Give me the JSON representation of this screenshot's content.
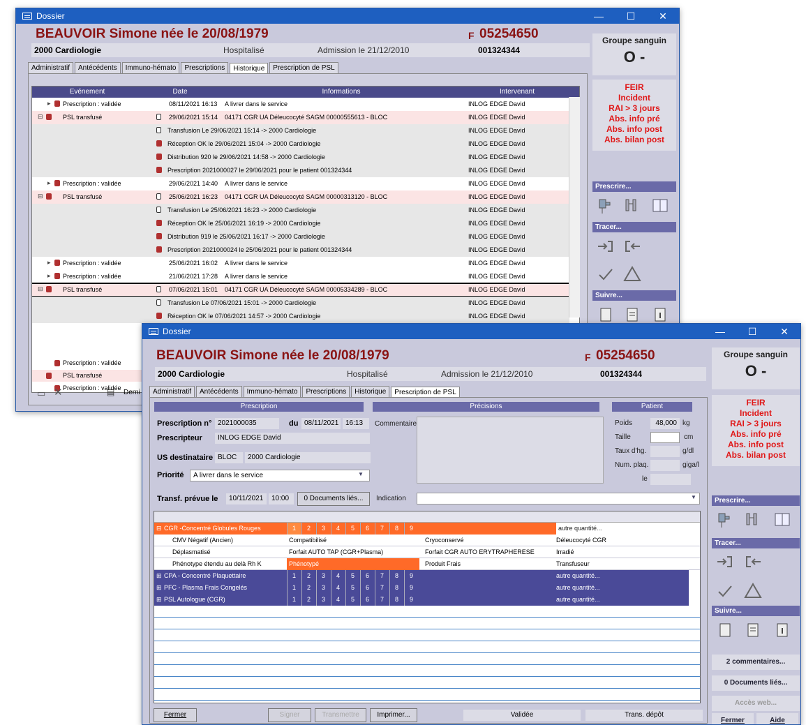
{
  "app": {
    "title": "Dossier"
  },
  "patient": {
    "name": "BEAUVOIR Simone née le 20/08/1979",
    "sex": "F",
    "number": "05254650",
    "service": "2000 Cardiologie",
    "status": "Hospitalisé",
    "admission": "Admission le 21/12/2010",
    "id": "001324344"
  },
  "blood": {
    "title": "Groupe sanguin",
    "value": "O -"
  },
  "alerts": [
    "FEIR",
    "Incident",
    "RAI > 3 jours",
    "Abs. info pré",
    "Abs. info post",
    "Abs. bilan post"
  ],
  "tabs": [
    "Administratif",
    "Antécédents",
    "Immuno-hémato",
    "Prescriptions",
    "Historique",
    "Prescription de PSL"
  ],
  "side": {
    "prescrire": "Prescrire...",
    "tracer": "Tracer...",
    "suivre": "Suivre...",
    "comments": "2 commentaires...",
    "docs": "0 Documents liés...",
    "acces_web": "Accès web...",
    "fermer": "Fermer",
    "aide": "Aide"
  },
  "history": {
    "columns": [
      "Evénement",
      "Date",
      "Informations",
      "Intervenant"
    ],
    "rows": [
      {
        "event": "Prescription : validée",
        "date": "08/11/2021 16:13",
        "info": "A livrer dans le service",
        "who": "INLOG EDGE David",
        "style": "w",
        "ico": "rx"
      },
      {
        "event": "PSL transfusé",
        "date": "29/06/2021 15:14",
        "info": "04171 CGR UA Déleucocyté SAGM 00000555613 - BLOC",
        "who": "INLOG EDGE David",
        "style": "p",
        "ico": "bag"
      },
      {
        "event": "",
        "date": "",
        "info": "Transfusion Le 29/06/2021 15:14 -> 2000 Cardiologie",
        "who": "INLOG EDGE David",
        "style": "g",
        "ico": "bag2"
      },
      {
        "event": "",
        "date": "",
        "info": "Réception OK le 29/06/2021 15:04 -> 2000 Cardiologie",
        "who": "INLOG EDGE David",
        "style": "g",
        "ico": "rec"
      },
      {
        "event": "",
        "date": "",
        "info": "Distribution 920 le 29/06/2021 14:58 -> 2000 Cardiologie",
        "who": "INLOG EDGE David",
        "style": "g",
        "ico": "dis"
      },
      {
        "event": "",
        "date": "",
        "info": "Prescription 2021000027 le 29/06/2021 pour le patient 001324344",
        "who": "INLOG EDGE David",
        "style": "g",
        "ico": "rx"
      },
      {
        "event": "Prescription : validée",
        "date": "29/06/2021 14:40",
        "info": "A livrer dans le service",
        "who": "INLOG EDGE David",
        "style": "w",
        "ico": "rx"
      },
      {
        "event": "PSL transfusé",
        "date": "25/06/2021 16:23",
        "info": "04171 CGR UA Déleucocyté SAGM 00000313120 - BLOC",
        "who": "INLOG EDGE David",
        "style": "p",
        "ico": "bag"
      },
      {
        "event": "",
        "date": "",
        "info": "Transfusion Le 25/06/2021 16:23 -> 2000 Cardiologie",
        "who": "INLOG EDGE David",
        "style": "g",
        "ico": "bag2"
      },
      {
        "event": "",
        "date": "",
        "info": "Réception OK le 25/06/2021 16:19 -> 2000 Cardiologie",
        "who": "INLOG EDGE David",
        "style": "g",
        "ico": "rec"
      },
      {
        "event": "",
        "date": "",
        "info": "Distribution 919 le 25/06/2021 16:17 -> 2000 Cardiologie",
        "who": "INLOG EDGE David",
        "style": "g",
        "ico": "dis"
      },
      {
        "event": "",
        "date": "",
        "info": "Prescription 2021000024 le 25/06/2021 pour le patient 001324344",
        "who": "INLOG EDGE David",
        "style": "g",
        "ico": "rx"
      },
      {
        "event": "Prescription : validée",
        "date": "25/06/2021 16:02",
        "info": "A livrer dans le service",
        "who": "INLOG EDGE David",
        "style": "w",
        "ico": "rx"
      },
      {
        "event": "Prescription : validée",
        "date": "21/06/2021 17:28",
        "info": "A livrer dans le service",
        "who": "INLOG EDGE David",
        "style": "w",
        "ico": "rx"
      },
      {
        "event": "PSL transfusé",
        "date": "07/06/2021 15:01",
        "info": "04171 CGR UA Déleucocyté SAGM 00005334289 - BLOC",
        "who": "INLOG EDGE David",
        "style": "p",
        "ico": "bag"
      },
      {
        "event": "",
        "date": "",
        "info": "Transfusion Le 07/06/2021 15:01 -> 2000 Cardiologie",
        "who": "INLOG EDGE David",
        "style": "g",
        "ico": "bag2"
      },
      {
        "event": "",
        "date": "",
        "info": "Réception OK le 07/06/2021 14:57 -> 2000 Cardiologie",
        "who": "INLOG EDGE David",
        "style": "g",
        "ico": "rec"
      }
    ],
    "tail": [
      {
        "event": "Prescription : validée"
      },
      {
        "event": "PSL transfusé"
      },
      {
        "event": "Prescription : validée"
      }
    ],
    "bottom_label": "Derni"
  },
  "form": {
    "band_prescription": "Prescription",
    "band_precisions": "Précisions",
    "band_patient": "Patient",
    "presc_no_label": "Prescription n°",
    "presc_no": "2021000035",
    "du_label": "du",
    "date": "08/11/2021",
    "time": "16:13",
    "commentaire_label": "Commentaire",
    "prescripteur_label": "Prescripteur",
    "prescripteur": "INLOG EDGE David",
    "us_label": "US destinataire",
    "us_code": "BLOC",
    "us_name": "2000 Cardiologie",
    "priorite_label": "Priorité",
    "priorite": "A livrer dans le service",
    "transf_label": "Transf. prévue le",
    "transf_date": "10/11/2021",
    "transf_time": "10:00",
    "docs_btn": "0 Documents liés...",
    "indication_label": "Indication",
    "poids_label": "Poids",
    "poids": "48,000",
    "poids_unit": "kg",
    "taille_label": "Taille",
    "taille_unit": "cm",
    "hg_label": "Taux d'hg.",
    "hg_unit": "g/dl",
    "plaq_label": "Num. plaq.",
    "plaq_unit": "giga/l",
    "le_label": "le"
  },
  "psl": {
    "numbers": [
      "1",
      "2",
      "3",
      "4",
      "5",
      "6",
      "7",
      "8",
      "9"
    ],
    "other": "autre quantité...",
    "cgr": "CGR -Concentré Globules Rouges",
    "options": [
      [
        "CMV Négatif (Ancien)",
        "Compatibilisé",
        "Cryoconservé",
        "Déleucocyté CGR"
      ],
      [
        "Déplasmatisé",
        "Forfait AUTO TAP (CGR+Plasma)",
        "Forfait CGR AUTO ERYTRAPHERESE",
        "Irradié"
      ],
      [
        "Phénotype étendu au delà Rh K",
        "Phénotypé",
        "Produit Frais",
        "Transfuseur"
      ]
    ],
    "others": [
      "CPA - Concentré Plaquettaire",
      "PFC - Plasma Frais Congelés",
      "PSL Autologue (CGR)"
    ]
  },
  "footer": {
    "fermer": "Fermer",
    "signer": "Signer",
    "transmettre": "Transmettre",
    "imprimer": "Imprimer...",
    "status1": "Validée",
    "status2": "Trans. dépôt"
  }
}
